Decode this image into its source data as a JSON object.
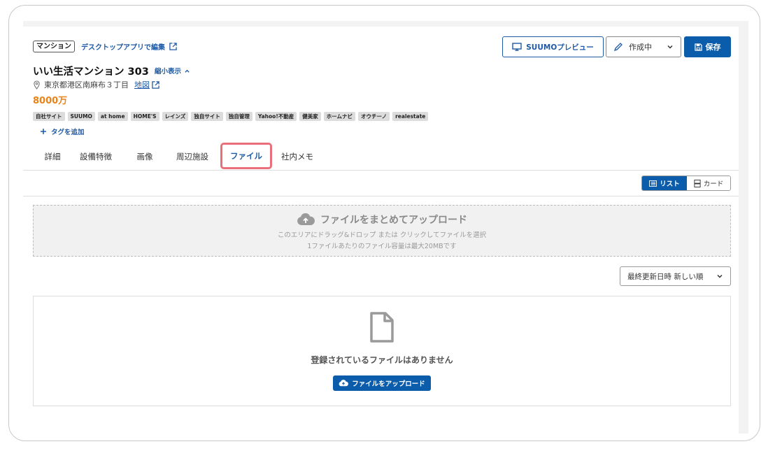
{
  "header": {
    "type_badge": "マンション",
    "desktop_link": "デスクトップアプリで編集",
    "title": "いい生活マンション 303",
    "collapse_label": "縮小表示",
    "address": "東京都港区南麻布３丁目",
    "map_label": "地図",
    "price": "8000万",
    "tags": [
      "自社サイト",
      "SUUMO",
      "at home",
      "HOME'S",
      "レインズ",
      "独自サイト",
      "独自管理",
      "Yahoo!不動産",
      "健美家",
      "ホームナビ",
      "オウチーノ",
      "realestate"
    ],
    "add_tag": "タグを追加"
  },
  "actions": {
    "preview": "SUUMOプレビュー",
    "status": "作成中",
    "save": "保存"
  },
  "tabs": [
    {
      "label": "詳細"
    },
    {
      "label": "設備特徴"
    },
    {
      "label": "画像"
    },
    {
      "label": "周辺施設"
    },
    {
      "label": "ファイル"
    },
    {
      "label": "社内メモ"
    }
  ],
  "view_toggle": {
    "list": "リスト",
    "card": "カード"
  },
  "dropzone": {
    "title": "ファイルをまとめてアップロード",
    "sub": "このエリアにドラッグ&ドロップ または クリックしてファイルを選択",
    "limit": "1ファイルあたりのファイル容量は最大20MBです"
  },
  "sort": {
    "selected": "最終更新日時 新しい順"
  },
  "empty": {
    "message": "登録されているファイルはありません",
    "upload_button": "ファイルをアップロード"
  },
  "colors": {
    "primary": "#0b5cab",
    "price": "#e8831a",
    "active_highlight": "#e8707a"
  }
}
